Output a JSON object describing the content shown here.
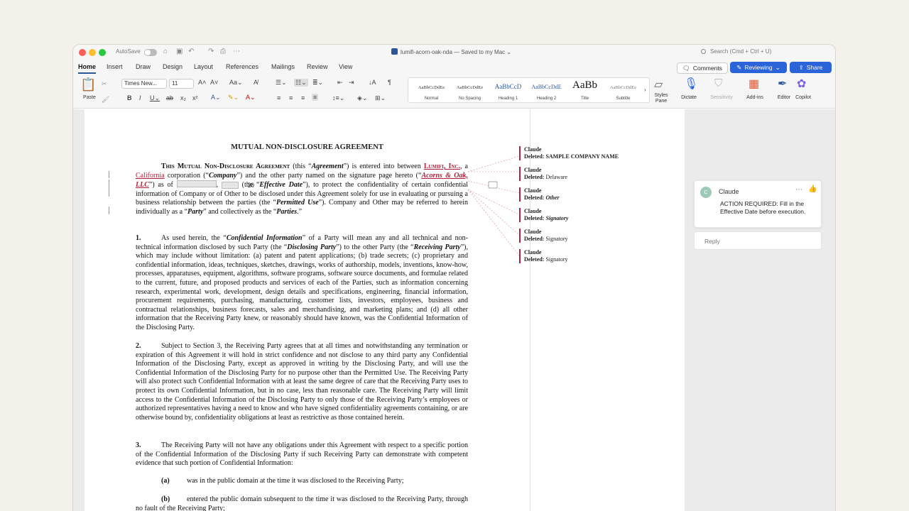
{
  "titlebar": {
    "autosave_label": "AutoSave",
    "doc_title": "lumifi-acorn-oak-nda — Saved to my Mac ⌄",
    "search_placeholder": "Search (Cmd + Ctrl + U)"
  },
  "menu": {
    "tabs": [
      "Home",
      "Insert",
      "Draw",
      "Design",
      "Layout",
      "References",
      "Mailings",
      "Review",
      "View"
    ],
    "comments_label": "Comments",
    "reviewing_label": "Reviewing",
    "share_label": "Share"
  },
  "ribbon": {
    "paste_label": "Paste",
    "font_name": "Times New...",
    "font_size": "11",
    "styles": [
      {
        "sample": "AaBbCcDdEe",
        "label": "Normal"
      },
      {
        "sample": "AaBbCcDdEe",
        "label": "No Spacing"
      },
      {
        "sample": "AaBbCcD",
        "label": "Heading 1"
      },
      {
        "sample": "AaBbCcDdE",
        "label": "Heading 2"
      },
      {
        "sample": "AaBb",
        "label": "Title"
      },
      {
        "sample": "AaBbCcDdEe",
        "label": "Subtitle"
      }
    ],
    "styles_pane_label": "Styles\nPane",
    "dictate_label": "Dictate",
    "sensitivity_label": "Sensitivity",
    "addins_label": "Add-ins",
    "editor_label": "Editor",
    "copilot_label": "Copilot"
  },
  "document": {
    "heading": "MUTUAL NON-DISCLOSURE AGREEMENT",
    "intro": {
      "p1": "This Mutual Non-Disclosure Agreement",
      "p2": " (this “",
      "p3": "Agreement",
      "p4": "”) is entered into between ",
      "company_ins": "Lumifi, Inc.",
      "p5": ", a ",
      "state_ins": "California",
      "p6": " corporation (“",
      "p7": "Company",
      "p8": "”) and the other party named on the signature page hereto (“",
      "other_ins": "Acorns & Oak, LLC",
      "p9": "”) as of ",
      "year": "20",
      "p10": " (the “",
      "p11": "Effective Date",
      "p12": "”), to protect the confidentiality of certain confidential information of Company or of Other to be disclosed under this Agreement solely for use in evaluating or pursuing a business relationship between the parties (the “",
      "p13": "Permitted Use",
      "p14": "”). Company and Other  may be referred to herein individually as a “",
      "p15": "Party",
      "p16": "” and collectively as the “",
      "p17": "Parties",
      "p18": ".”"
    },
    "s1": {
      "num": "1.",
      "a": "As used herein, the “",
      "b": "Confidential Information",
      "c": "” of a Party will mean any and all technical and non-technical information disclosed by such Party (the “",
      "d": "Disclosing Party",
      "e": "”) to the other Party (the “",
      "f": "Receiving Party",
      "g": "”), which may include without limitation: (a) patent and patent applications; (b) trade secrets; (c) proprietary and confidential information, ideas, techniques, sketches, drawings, works of authorship, models, inventions, know-how, processes, apparatuses, equipment, algorithms, software programs, software source documents, and formulae related to the current, future, and proposed products and services of each of the Parties, such as information concerning research, experimental work, development, design details and specifications, engineering, financial information, procurement requirements, purchasing, manufacturing, customer lists, investors, employees, business and contractual relationships, business forecasts, sales and merchandising, and marketing plans; and (d) all other information that the Receiving Party knew, or reasonably should have known, was the Confidential Information of the Disclosing Party."
    },
    "s2": {
      "num": "2.",
      "text": "Subject to Section 3, the Receiving Party agrees that at all times and notwithstanding any termination or expiration of this Agreement it will hold in strict confidence and not disclose to any third party any Confidential Information of the Disclosing Party, except as approved in writing by the Disclosing Party, and will use the Confidential Information of the Disclosing Party for no purpose other than the Permitted Use. The Receiving Party will also protect such Confidential Information with at least the same degree of care that the Receiving Party uses to protect its own Confidential Information, but in no case, less than reasonable care. The Receiving Party will limit access to the Confidential Information of the Disclosing Party to only those of the Receiving Party’s employees or authorized representatives having a need to know and who have signed confidentiality agreements containing, or are otherwise bound by, confidentiality obligations at least as restrictive as those contained herein."
    },
    "s3": {
      "num": "3.",
      "text": "The Receiving Party will not have any obligations under this Agreement with respect to a specific portion of the Confidential Information of the Disclosing Party if such Receiving Party can demonstrate with competent evidence that such portion of Confidential Information:"
    },
    "sub_a": {
      "label": "(a)",
      "text": "was in the public domain at the time it was disclosed to the Receiving Party;"
    },
    "sub_b": {
      "label": "(b)",
      "text": "entered the public domain subsequent to the time it was disclosed to the Receiving Party, through no fault of the Receiving Party;"
    }
  },
  "balloons": [
    {
      "author": "Claude",
      "deleted_label": "Deleted:",
      "value": "SAMPLE COMPANY NAME"
    },
    {
      "author": "Claude",
      "deleted_label": "Deleted:",
      "value": "Delaware"
    },
    {
      "author": "Claude",
      "deleted_label": "Deleted:",
      "value": "Other"
    },
    {
      "author": "Claude",
      "deleted_label": "Deleted:",
      "value": "Signatory"
    },
    {
      "author": "Claude",
      "deleted_label": "Deleted:",
      "value": "Signatory"
    },
    {
      "author": "Claude",
      "deleted_label": "Deleted:",
      "value": "Signatory"
    }
  ],
  "comment": {
    "avatar_initial": "C",
    "author": "Claude",
    "text": "ACTION REQUIRED: Fill in the Effective Date before execution.",
    "reply_placeholder": "Reply"
  },
  "colors": {
    "accent": "#2b63d9",
    "revision": "#b0223c"
  }
}
